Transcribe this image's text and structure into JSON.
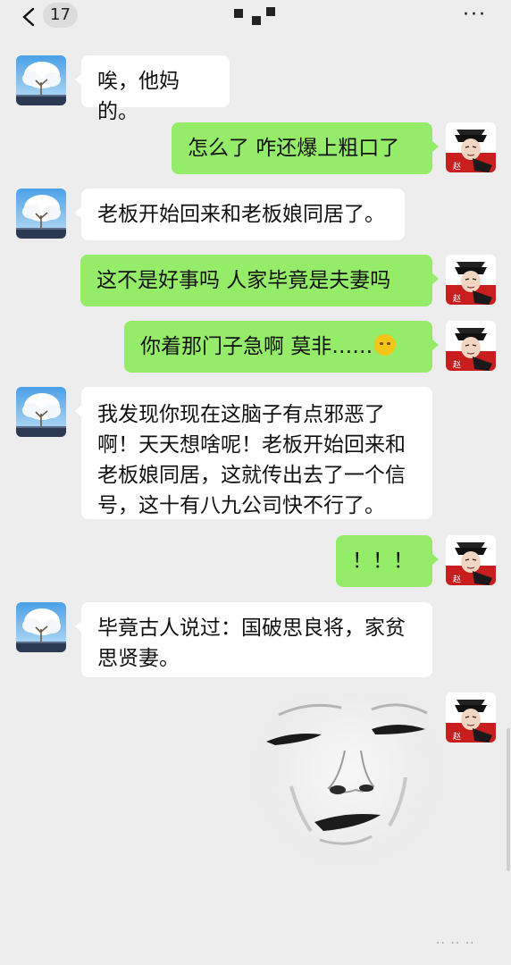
{
  "header": {
    "unread_count": "17",
    "menu_glyph": "···"
  },
  "messages": [
    {
      "side": "left",
      "text": "唉，他妈的。"
    },
    {
      "side": "right",
      "text": "怎么了  咋还爆上粗口了"
    },
    {
      "side": "left",
      "text": "老板开始回来和老板娘同居了。"
    },
    {
      "side": "right",
      "text": "这不是好事吗  人家毕竟是夫妻吗"
    },
    {
      "side": "right",
      "text": "你着那门子急啊  莫非……",
      "emoji": "thinking-face-emoji"
    },
    {
      "side": "left",
      "text": "我发现你现在这脑子有点邪恶了啊！天天想啥呢！老板开始回来和老板娘同居，这就传出去了一个信号，这十有八九公司快不行了。"
    },
    {
      "side": "right",
      "text": "！！！"
    },
    {
      "side": "left",
      "text": "毕竟古人说过：国破思良将，家贫思贤妻。"
    },
    {
      "side": "right",
      "sticker": "smug-face-sticker"
    }
  ],
  "avatars": {
    "friend": "tree-avatar-icon",
    "me": "costume-man-avatar-icon",
    "me_badge": "赵"
  },
  "watermark": "·· ·· ··"
}
